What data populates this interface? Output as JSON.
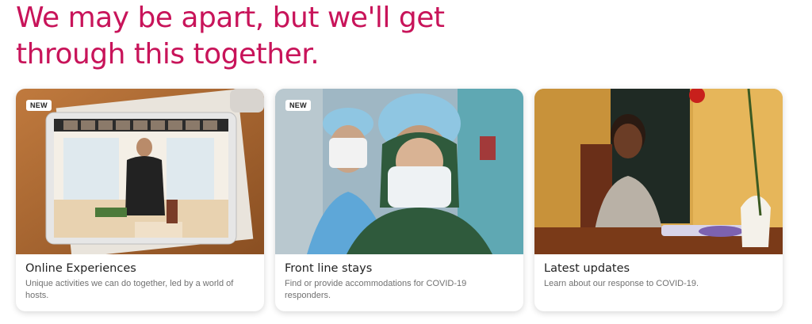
{
  "theme": {
    "accent": "#C8145A",
    "text": "#222222",
    "muted": "#717171"
  },
  "headline": {
    "line1": "We may be apart, but we'll get",
    "line2": "through this together."
  },
  "cards": [
    {
      "badge": "NEW",
      "title": "Online Experiences",
      "description": "Unique activities we can do together, led by a world of hosts.",
      "image": "tablet-video-call-photo"
    },
    {
      "badge": "NEW",
      "title": "Front line stays",
      "description": "Find or provide accommodations for COVID-19 responders.",
      "image": "masked-healthcare-workers-photo"
    },
    {
      "badge": "",
      "title": "Latest updates",
      "description": "Learn about our response to COVID-19.",
      "image": "woman-at-table-photo"
    }
  ]
}
